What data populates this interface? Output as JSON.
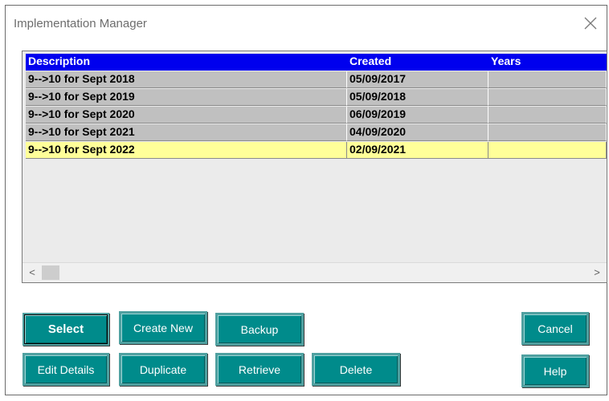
{
  "window": {
    "title": "Implementation Manager",
    "close_symbol": "✕"
  },
  "grid": {
    "columns": [
      "Description",
      "Created",
      "Years"
    ],
    "rows": [
      {
        "description": "9-->10 for Sept 2018",
        "created": "05/09/2017",
        "years": ""
      },
      {
        "description": "9-->10 for Sept 2019",
        "created": "05/09/2018",
        "years": ""
      },
      {
        "description": "9-->10 for Sept 2020",
        "created": "06/09/2019",
        "years": ""
      },
      {
        "description": "9-->10 for Sept 2021",
        "created": "04/09/2020",
        "years": ""
      },
      {
        "description": "9-->10 for Sept 2022",
        "created": "02/09/2021",
        "years": ""
      }
    ],
    "selected_index": 4,
    "scroll_left_symbol": "<",
    "scroll_right_symbol": ">"
  },
  "buttons": {
    "select": "Select",
    "create_new": "Create New",
    "backup": "Backup",
    "cancel": "Cancel",
    "edit_details": "Edit Details",
    "duplicate": "Duplicate",
    "retrieve": "Retrieve",
    "delete": "Delete",
    "help": "Help"
  },
  "colors": {
    "header_bg": "#0000ee",
    "row_bg": "#c0c0c0",
    "selected_row_bg": "#ffff99",
    "button_bg": "#008b8b"
  }
}
